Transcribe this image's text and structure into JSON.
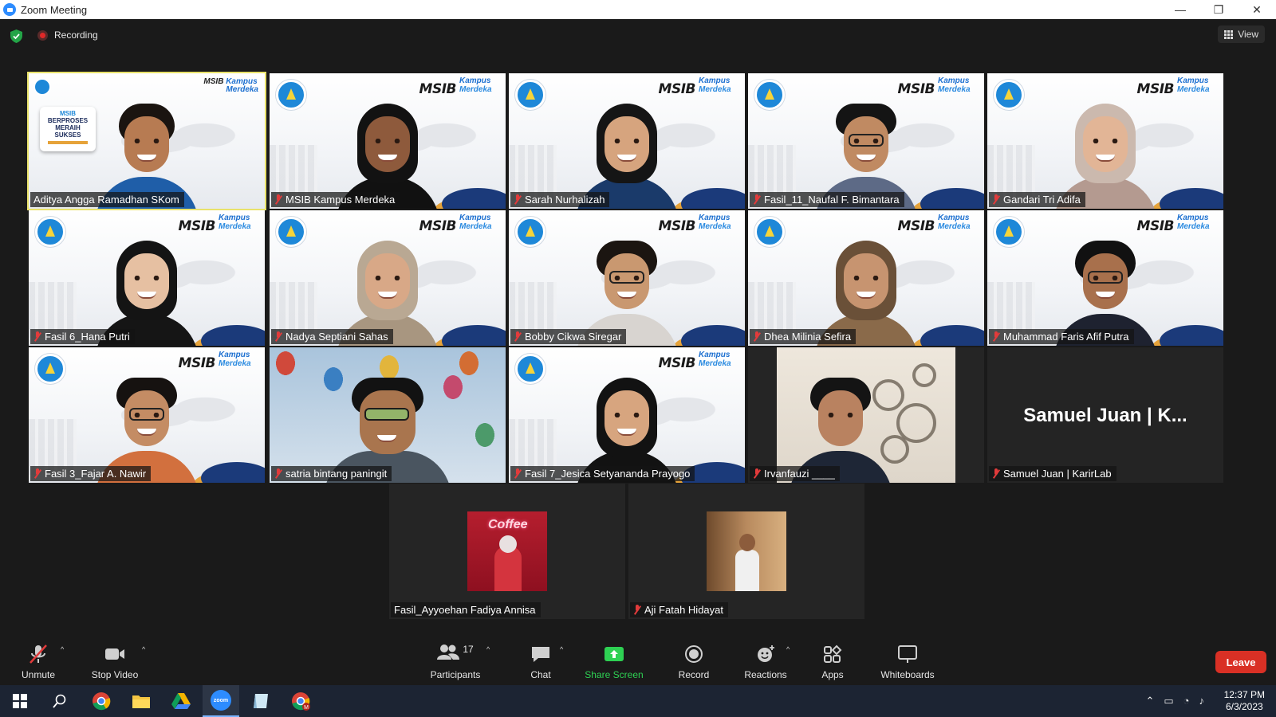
{
  "window": {
    "title": "Zoom Meeting",
    "minimize": "—",
    "restore": "❐",
    "close": "✕"
  },
  "meeting": {
    "recording_label": "Recording",
    "view_label": "View"
  },
  "participants": [
    {
      "name": "Aditya Angga Ramadhan SKom",
      "muted": false,
      "active": true
    },
    {
      "name": "MSIB Kampus Merdeka",
      "muted": true
    },
    {
      "name": "Sarah Nurhalizah",
      "muted": true
    },
    {
      "name": "Fasil_11_Naufal F. Bimantara",
      "muted": true
    },
    {
      "name": "Gandari Tri Adifa",
      "muted": true
    },
    {
      "name": "Fasil 6_Hana Putri",
      "muted": true
    },
    {
      "name": "Nadya Septiani Sahas",
      "muted": true
    },
    {
      "name": "Bobby Cikwa Siregar",
      "muted": true
    },
    {
      "name": "Dhea Milinia Sefira",
      "muted": true
    },
    {
      "name": "Muhammad Faris Afif Putra",
      "muted": true
    },
    {
      "name": "Fasil 3_Fajar A. Nawir",
      "muted": true
    },
    {
      "name": "satria bintang paningit",
      "muted": true
    },
    {
      "name": "Fasil 7_Jesica Setyananda Prayogo",
      "muted": true
    },
    {
      "name": "Irvanfauzi ____",
      "muted": true
    },
    {
      "name": "Samuel Juan | KarirLab",
      "muted": true,
      "display_name": "Samuel Juan | K..."
    },
    {
      "name": "Fasil_Ayyoehan Fadiya Annisa",
      "muted": false
    },
    {
      "name": "Aji Fatah Hidayat",
      "muted": true
    }
  ],
  "first_tile_sign": {
    "line1": "MSIB",
    "line2": "BERPROSES",
    "line3": "MERAIH",
    "line4": "SUKSES"
  },
  "tile_logos": {
    "msib": "MSIB",
    "kampus": "Kampus",
    "merdeka": "Merdeka"
  },
  "coffee_sign": "Coffee",
  "toolbar": {
    "unmute": "Unmute",
    "stop_video": "Stop Video",
    "participants": "Participants",
    "participants_count": "17",
    "chat": "Chat",
    "share_screen": "Share Screen",
    "record": "Record",
    "reactions": "Reactions",
    "apps": "Apps",
    "whiteboards": "Whiteboards",
    "leave": "Leave"
  },
  "taskbar": {
    "time": "12:37 PM",
    "date": "6/3/2023",
    "zoom_label": "zoom",
    "chrome_profile_letter": "M"
  },
  "colors": {
    "accent_green": "#2ed153",
    "leave_red": "#d93025",
    "active_speaker": "#e9e26a",
    "muted_red": "#e23b3b"
  }
}
